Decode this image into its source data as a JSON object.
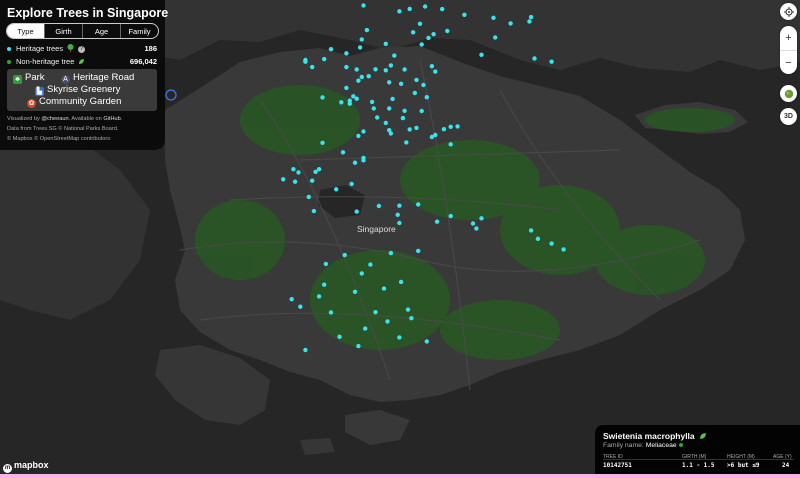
{
  "map": {
    "place_label": "Singapore",
    "colors": {
      "background": "#2a2a2a",
      "land": "#3a3a3a",
      "water": "#262626",
      "green": "#1e6a18",
      "heritage_dot": "#37e5f0",
      "location_ring": "#3d7be0"
    },
    "heritage_trees_shown": [
      [
        101.2,
        1.45
      ],
      [
        104.8,
        1.4
      ],
      [
        103.9,
        1.27
      ],
      [
        103.3,
        1.14
      ],
      [
        105.8,
        1.26
      ],
      [
        111.0,
        0.83
      ],
      [
        108.8,
        0.79
      ],
      [
        107.1,
        0.95
      ],
      [
        109.8,
        0.49
      ],
      [
        110.9,
        0.59
      ],
      [
        104.5,
        0.47
      ],
      [
        101.4,
        0.13
      ],
      [
        106.1,
        0.08
      ],
      [
        104.1,
        0.01
      ],
      [
        105.0,
        -0.29
      ],
      [
        105.3,
        -0.09
      ],
      [
        108.9,
        -0.27
      ],
      [
        104.6,
        -0.64
      ],
      [
        102.5,
        -0.61
      ],
      [
        101.1,
        -0.37
      ],
      [
        101.0,
        -0.8
      ],
      [
        99.3,
        -0.9
      ],
      [
        100.2,
        -1.12
      ],
      [
        103.0,
        -1.24
      ],
      [
        108.1,
        -1.2
      ],
      [
        111.2,
        -1.4
      ],
      [
        112.2,
        -1.57
      ],
      [
        98.9,
        -1.43
      ],
      [
        97.8,
        -1.57
      ],
      [
        97.8,
        -1.48
      ],
      [
        102.8,
        -1.77
      ],
      [
        105.2,
        -1.81
      ],
      [
        98.2,
        -1.86
      ],
      [
        100.2,
        -1.86
      ],
      [
        100.8,
        -1.99
      ],
      [
        101.9,
        -1.98
      ],
      [
        102.5,
        -2.03
      ],
      [
        103.6,
        -1.99
      ],
      [
        105.4,
        -2.1
      ],
      [
        101.1,
        -2.39
      ],
      [
        101.5,
        -2.35
      ],
      [
        104.3,
        -2.55
      ],
      [
        103.4,
        -2.76
      ],
      [
        104.7,
        -2.82
      ],
      [
        102.7,
        -2.68
      ],
      [
        98.8,
        -3.49
      ],
      [
        100.8,
        -3.56
      ],
      [
        100.4,
        -3.66
      ],
      [
        99.9,
        -3.75
      ],
      [
        100.4,
        -3.83
      ],
      [
        100.6,
        -3.43
      ],
      [
        100.2,
        -2.98
      ],
      [
        100.9,
        -2.59
      ],
      [
        104.2,
        -3.25
      ],
      [
        104.9,
        -3.48
      ],
      [
        102.9,
        -3.57
      ],
      [
        101.7,
        -3.73
      ],
      [
        101.8,
        -4.08
      ],
      [
        102.7,
        -4.08
      ],
      [
        103.6,
        -4.21
      ],
      [
        104.6,
        -4.22
      ],
      [
        103.5,
        -4.6
      ],
      [
        102.0,
        -4.57
      ],
      [
        102.5,
        -4.86
      ],
      [
        104.3,
        -5.13
      ],
      [
        102.7,
        -5.25
      ],
      [
        102.8,
        -5.43
      ],
      [
        103.9,
        -5.21
      ],
      [
        106.7,
        -5.05
      ],
      [
        106.3,
        -5.07
      ],
      [
        105.9,
        -5.2
      ],
      [
        105.4,
        -5.51
      ],
      [
        105.2,
        -5.62
      ],
      [
        106.3,
        -6.01
      ],
      [
        103.7,
        -5.91
      ],
      [
        101.2,
        -5.32
      ],
      [
        100.9,
        -5.56
      ],
      [
        98.8,
        -5.93
      ],
      [
        100.0,
        -6.44
      ],
      [
        101.2,
        -6.74
      ],
      [
        101.2,
        -6.87
      ],
      [
        100.7,
        -7.0
      ],
      [
        98.6,
        -7.35
      ],
      [
        98.4,
        -7.49
      ],
      [
        97.4,
        -7.52
      ],
      [
        97.1,
        -7.35
      ],
      [
        96.5,
        -7.89
      ],
      [
        97.2,
        -8.02
      ],
      [
        98.2,
        -7.97
      ],
      [
        100.5,
        -8.14
      ],
      [
        99.6,
        -8.43
      ],
      [
        98.0,
        -8.84
      ],
      [
        98.3,
        -9.6
      ],
      [
        100.8,
        -9.63
      ],
      [
        102.1,
        -9.33
      ],
      [
        103.3,
        -9.31
      ],
      [
        104.4,
        -9.24
      ],
      [
        103.2,
        -9.8
      ],
      [
        103.3,
        -10.24
      ],
      [
        105.5,
        -10.17
      ],
      [
        106.3,
        -9.87
      ],
      [
        108.1,
        -9.99
      ],
      [
        107.6,
        -10.27
      ],
      [
        107.8,
        -10.54
      ],
      [
        111.0,
        -10.64
      ],
      [
        111.4,
        -11.09
      ],
      [
        112.2,
        -11.35
      ],
      [
        112.9,
        -11.66
      ],
      [
        102.8,
        -11.86
      ],
      [
        104.4,
        -11.74
      ],
      [
        100.1,
        -11.97
      ],
      [
        99.0,
        -12.44
      ],
      [
        101.6,
        -12.48
      ],
      [
        101.1,
        -12.95
      ],
      [
        103.4,
        -13.41
      ],
      [
        102.4,
        -13.77
      ],
      [
        98.9,
        -13.56
      ],
      [
        100.7,
        -13.94
      ],
      [
        98.6,
        -14.19
      ],
      [
        97.0,
        -14.34
      ],
      [
        97.5,
        -14.74
      ],
      [
        99.3,
        -15.05
      ],
      [
        101.9,
        -15.04
      ],
      [
        103.8,
        -14.9
      ],
      [
        104.0,
        -15.36
      ],
      [
        102.6,
        -15.54
      ],
      [
        101.3,
        -15.92
      ],
      [
        99.8,
        -16.36
      ],
      [
        103.3,
        -16.39
      ],
      [
        104.9,
        -16.61
      ],
      [
        100.9,
        -16.86
      ],
      [
        97.8,
        -17.07
      ]
    ],
    "location_marker": "location-ring"
  },
  "panel": {
    "title": "Explore Trees in Singapore",
    "tabs": [
      {
        "label": "Type",
        "active": true
      },
      {
        "label": "Girth",
        "active": false
      },
      {
        "label": "Age",
        "active": false
      },
      {
        "label": "Family",
        "active": false
      }
    ],
    "heritage": {
      "label": "Heritage trees",
      "icon": "tree-icon",
      "help": "?",
      "count": "186",
      "color": "#37e5f0"
    },
    "non_heritage": {
      "label": "Non-heritage tree",
      "icon": "leaf-icon",
      "count": "696,042",
      "color": "#2fa82a"
    },
    "legend": [
      {
        "label": "Park",
        "icon": "park-icon",
        "color": "#2f9b3a"
      },
      {
        "label": "Heritage Road",
        "icon": "road-icon",
        "color": "#4a4f6b"
      },
      {
        "label": "Skyrise Greenery",
        "icon": "building-icon",
        "color": "#2c6fd4"
      },
      {
        "label": "Community Garden",
        "icon": "flower-icon",
        "color": "#d8482a"
      }
    ],
    "credits": {
      "line1_prefix": "Visualized by ",
      "author": "@cheeaun",
      "line1_mid": ". Available on ",
      "repo": "GitHub",
      "line1_suffix": ".",
      "line2": "Data from Trees.SG © National Parks Board.",
      "line3": "© Mapbox © OpenStreetMap contributors"
    }
  },
  "controls": {
    "locate": {
      "icon": "crosshair-icon"
    },
    "zoom_in": {
      "label": "+"
    },
    "zoom_out": {
      "label": "−"
    },
    "layer": {
      "icon": "globe-icon"
    },
    "view3d": {
      "label": "3D"
    }
  },
  "info_card": {
    "species": "Swietenia macrophylla",
    "family_label": "Family name:",
    "family": "Meliaceae",
    "columns": [
      {
        "header": "TREE ID",
        "value": "10142751"
      },
      {
        "header": "GIRTH (M)",
        "value": "1.1 - 1.5"
      },
      {
        "header": "HEIGHT (M)",
        "value": ">6 but ≤9"
      },
      {
        "header": "AGE (Y)",
        "value": "24"
      }
    ]
  },
  "attribution": {
    "logo": "mapbox"
  }
}
